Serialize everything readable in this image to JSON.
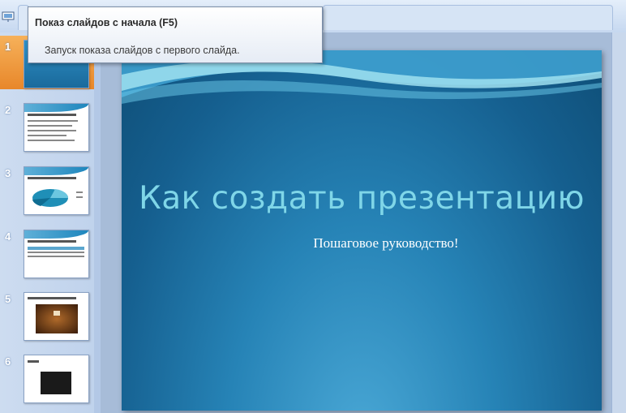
{
  "tooltip": {
    "title": "Показ слайдов с начала (F5)",
    "description": "Запуск показа слайдов с первого слайда."
  },
  "slide_pane": {
    "thumbnails": [
      {
        "number": "1",
        "selected": true
      },
      {
        "number": "2",
        "selected": false
      },
      {
        "number": "3",
        "selected": false
      },
      {
        "number": "4",
        "selected": false
      },
      {
        "number": "5",
        "selected": false
      },
      {
        "number": "6",
        "selected": false
      }
    ]
  },
  "slide": {
    "title": "Как создать презентацию",
    "subtitle": "Пошаговое руководство!"
  },
  "colors": {
    "selection": "#e8872a",
    "slide_bg": "#1e74a8",
    "title_text": "#7fd6e8"
  },
  "icons": {
    "quick_access": "slideshow-icon"
  }
}
